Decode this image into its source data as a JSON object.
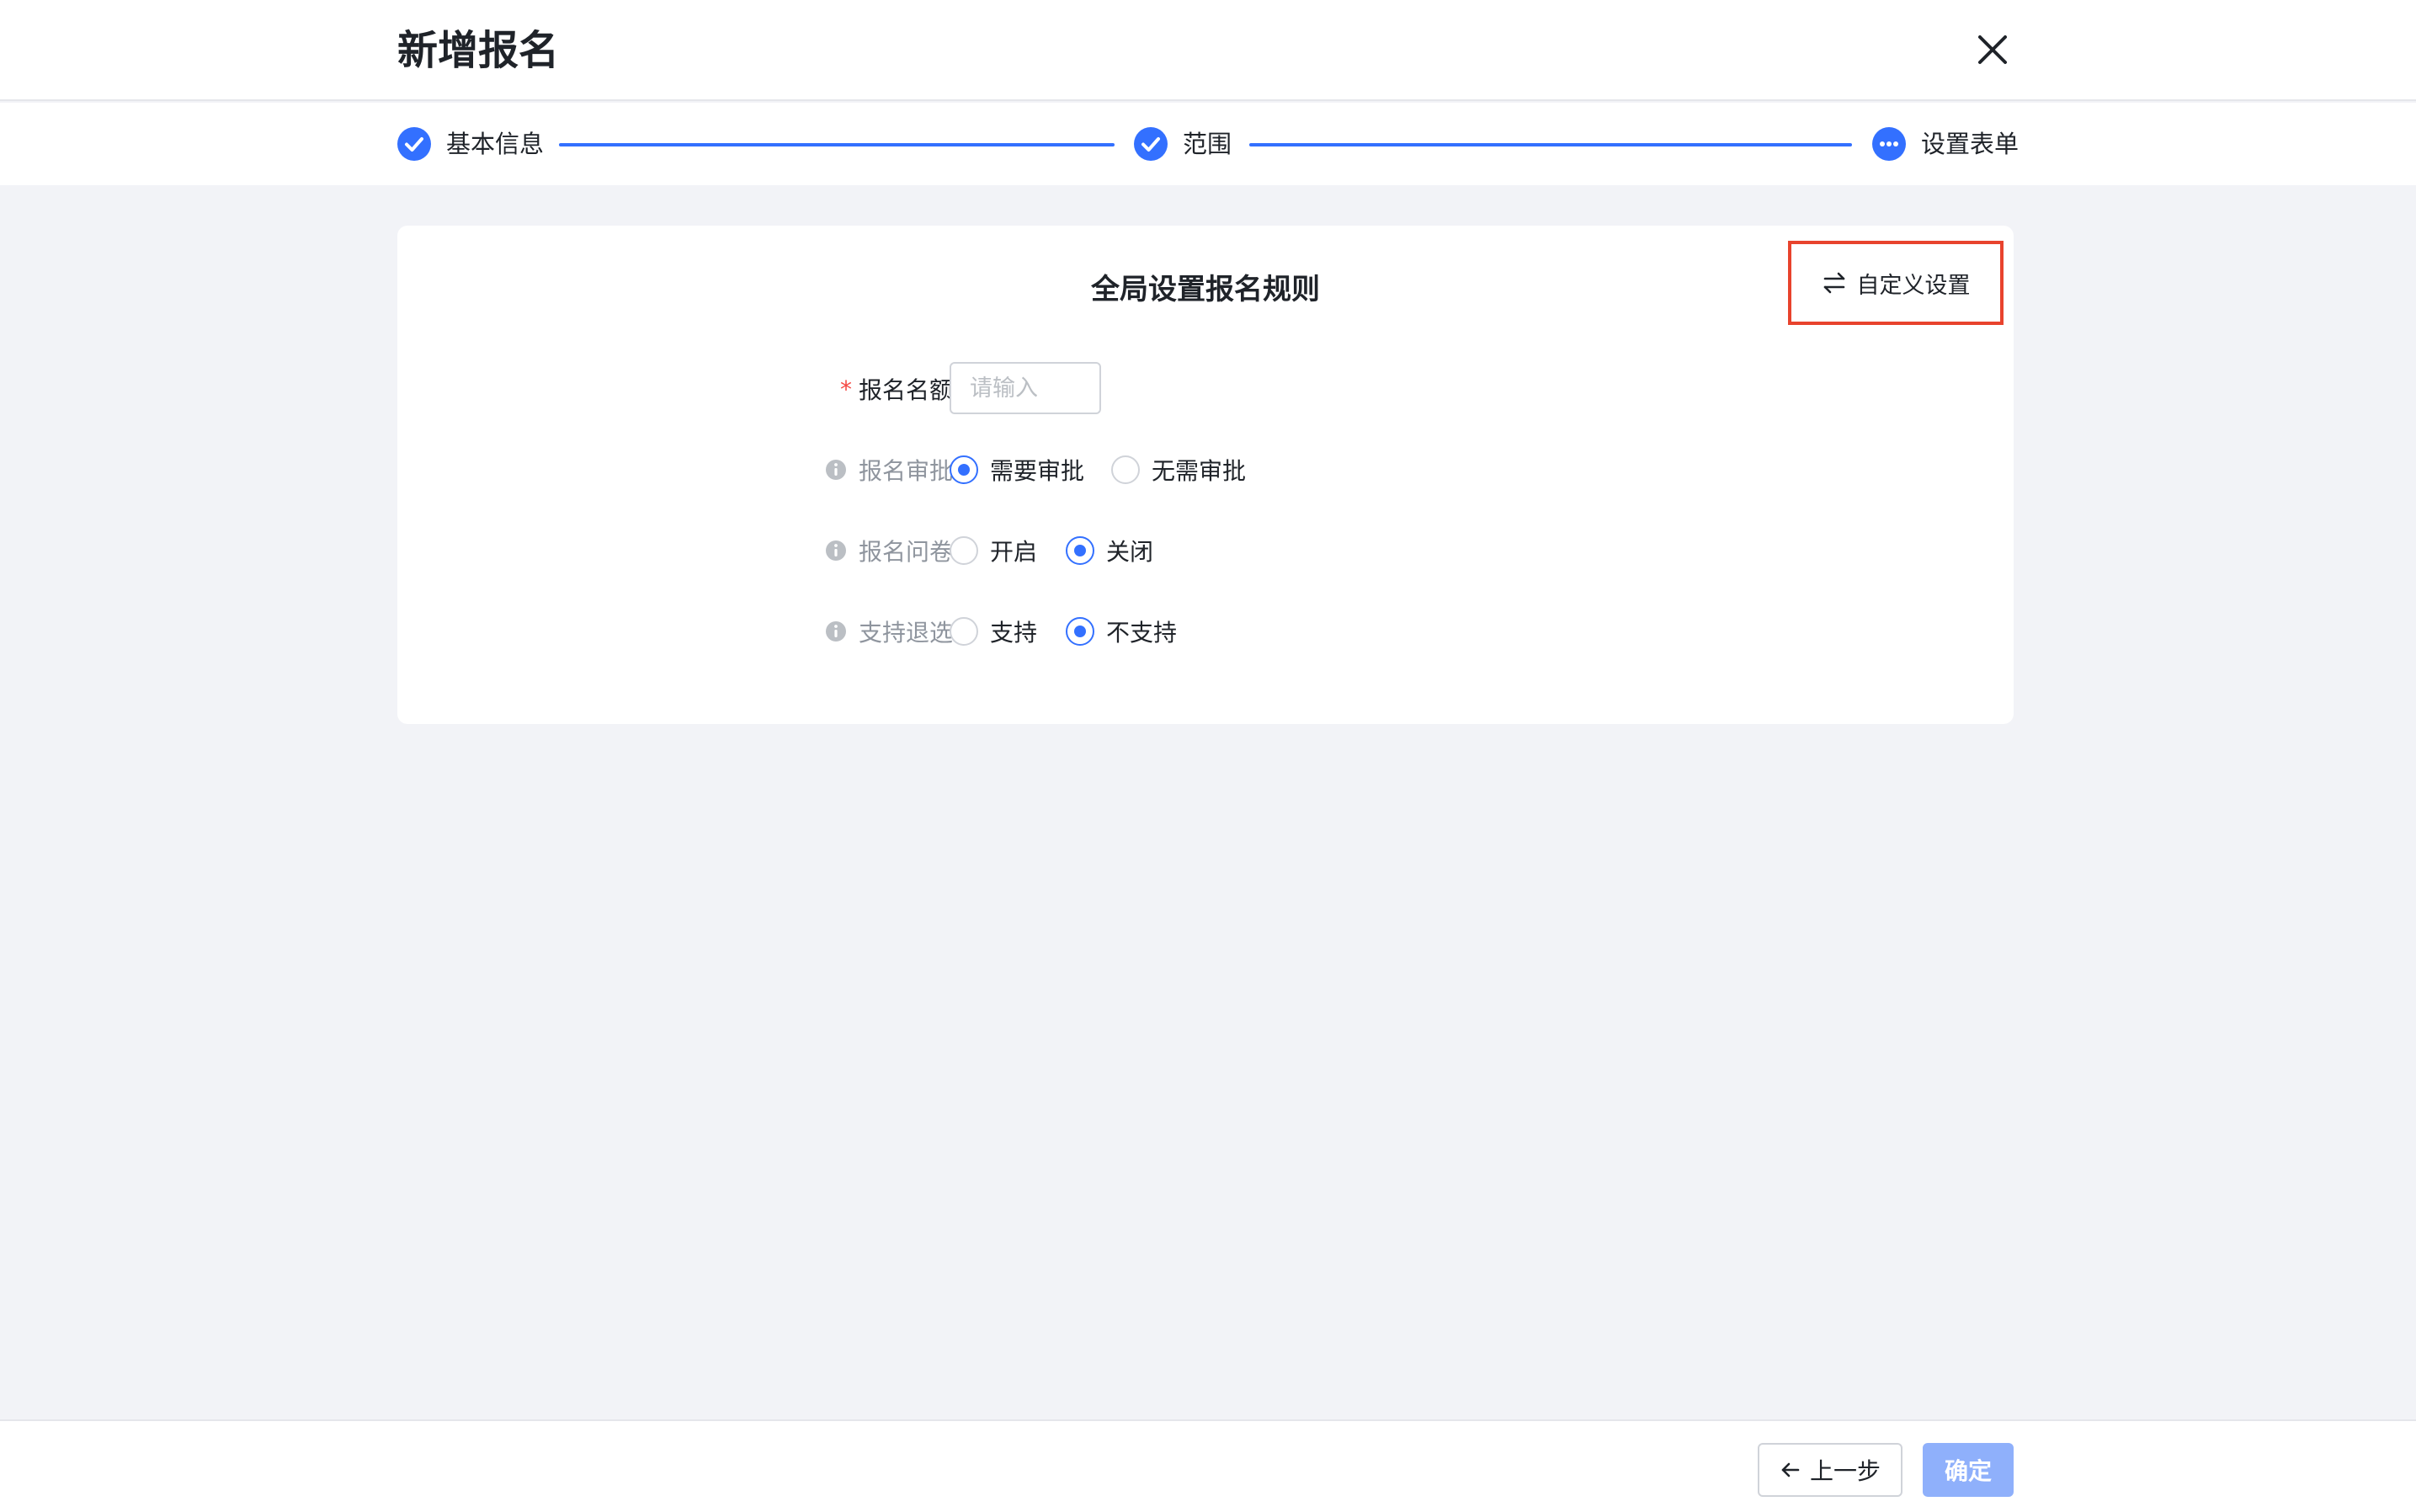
{
  "header": {
    "title": "新增报名"
  },
  "steps": [
    {
      "label": "基本信息",
      "status": "done"
    },
    {
      "label": "范围",
      "status": "done"
    },
    {
      "label": "设置表单",
      "status": "current"
    }
  ],
  "card": {
    "title": "全局设置报名规则",
    "custom_button_label": "自定义设置"
  },
  "form": {
    "quota": {
      "label": "报名名额",
      "required_mark": "*",
      "value": "",
      "placeholder": "请输入"
    },
    "approval": {
      "label": "报名审批",
      "options": [
        "需要审批",
        "无需审批"
      ],
      "selected": "需要审批"
    },
    "questionnaire": {
      "label": "报名问卷",
      "options": [
        "开启",
        "关闭"
      ],
      "selected": "关闭"
    },
    "withdraw": {
      "label": "支持退选",
      "options": [
        "支持",
        "不支持"
      ],
      "selected": "不支持"
    }
  },
  "footer": {
    "prev_label": "上一步",
    "ok_label": "确定"
  },
  "colors": {
    "primary": "#3370ff",
    "primary_disabled": "#8fb0fb",
    "highlight_border": "#e8432d",
    "required": "#f54a45",
    "background": "#f2f3f7"
  }
}
